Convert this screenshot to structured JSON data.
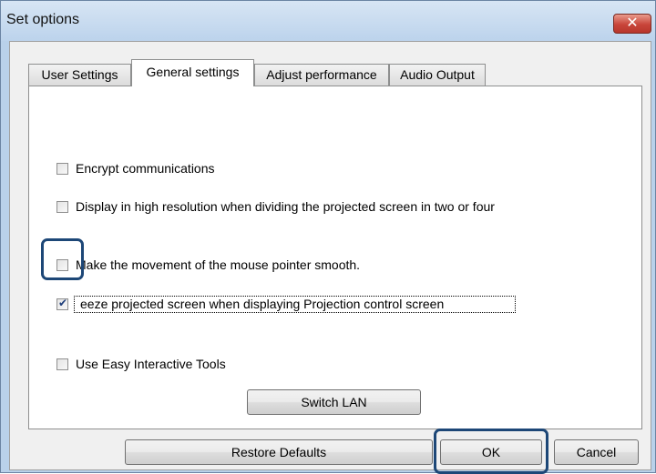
{
  "window": {
    "title": "Set options",
    "close_glyph": "✕"
  },
  "tabs": [
    {
      "label": "User Settings",
      "active": false
    },
    {
      "label": "General settings",
      "active": true
    },
    {
      "label": "Adjust performance",
      "active": false
    },
    {
      "label": "Audio Output",
      "active": false
    }
  ],
  "options": [
    {
      "label": "Encrypt communications",
      "checked": false
    },
    {
      "label": "Display in high resolution when dividing the projected screen in two or four",
      "checked": false
    },
    {
      "label": "Make the movement of the mouse pointer smooth.",
      "checked": false
    },
    {
      "label": "eeze projected screen when displaying Projection control screen",
      "checked": true
    },
    {
      "label": "Use Easy Interactive Tools",
      "checked": false
    }
  ],
  "buttons": {
    "switch_lan": "Switch LAN",
    "restore_defaults": "Restore Defaults",
    "ok": "OK",
    "cancel": "Cancel"
  },
  "colors": {
    "highlight": "#1d4777",
    "title_bar": "#bcd3ec",
    "close_button": "#c8453a"
  },
  "icons": {
    "close": "close-icon",
    "check": "checkmark-icon"
  }
}
